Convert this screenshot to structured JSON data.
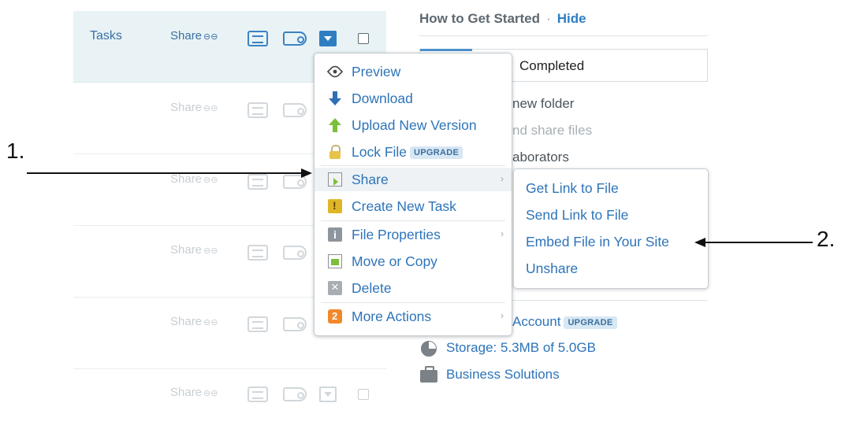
{
  "file_list": {
    "header": {
      "tasks_label": "Tasks",
      "share_label": "Share",
      "link_glyph": "⊖⊖"
    },
    "rows": [
      {
        "share_label": "Share"
      },
      {
        "share_label": "Share"
      },
      {
        "share_label": "Share"
      },
      {
        "share_label": "Share"
      },
      {
        "share_label": "Share"
      }
    ]
  },
  "context_menu": {
    "items": [
      {
        "label": "Preview",
        "icon": "eye-icon"
      },
      {
        "label": "Download",
        "icon": "download-arrow-icon"
      },
      {
        "label": "Upload New Version",
        "icon": "upload-arrow-icon"
      },
      {
        "label": "Lock File",
        "icon": "lock-icon",
        "badge": "UPGRADE"
      },
      {
        "label": "Share",
        "icon": "share-mail-icon",
        "chevron": "›"
      },
      {
        "label": "Create New Task",
        "icon": "task-icon"
      },
      {
        "label": "File Properties",
        "icon": "info-icon",
        "chevron": "›"
      },
      {
        "label": "Move or Copy",
        "icon": "move-copy-icon"
      },
      {
        "label": "Delete",
        "icon": "delete-icon"
      },
      {
        "label": "More Actions",
        "icon": "more-actions-icon",
        "chevron": "›"
      }
    ]
  },
  "share_submenu": {
    "items": [
      {
        "label": "Get Link to File"
      },
      {
        "label": "Send Link to File"
      },
      {
        "label": "Embed File in Your Site"
      },
      {
        "label": "Unshare"
      }
    ]
  },
  "getting_started": {
    "title": "How to Get Started",
    "separator": "·",
    "hide_label": "Hide",
    "completed_label": "Completed",
    "steps": [
      "new folder",
      "nd share files",
      "aborators"
    ],
    "account_label": "Account",
    "account_badge": "UPGRADE",
    "storage_label": "Storage: 5.3MB of 5.0GB",
    "business_label": "Business Solutions"
  },
  "annotations": {
    "label_1": "1.",
    "label_2": "2."
  },
  "colors": {
    "link_blue": "#2d74b9",
    "header_bg": "#e9f3f5",
    "accent_blue": "#2f7ec2"
  }
}
